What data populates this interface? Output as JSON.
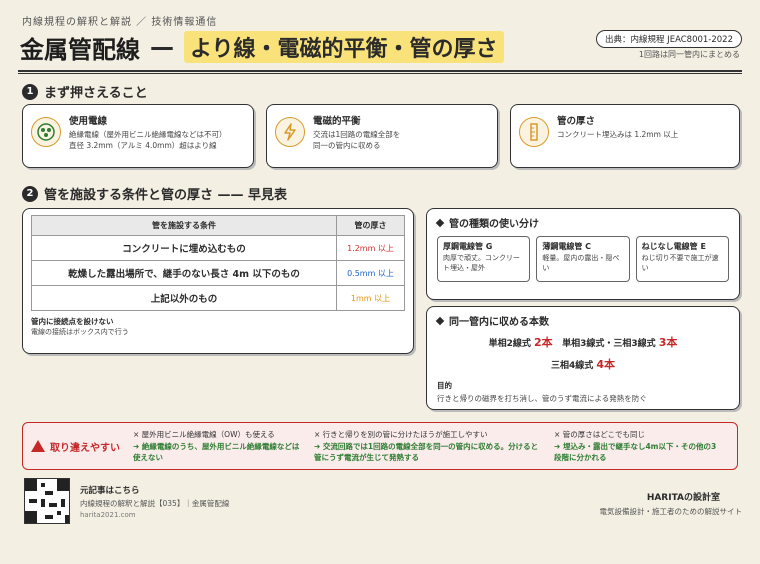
{
  "header": {
    "breadcrumb": "内線規程の解釈と解説 ／ 技術情報通信",
    "title_main": "金属管配線",
    "title_dash": "—",
    "title_sub": "より線・電磁的平衡・管の厚さ",
    "source": "出典：内線規程 JEAC8001-2022",
    "source_note": "1回路は同一管内にまとめる"
  },
  "section1": {
    "number": "1",
    "title": "まず押さえること",
    "cards": [
      {
        "title": "使用電線",
        "text1": "絶縁電線（屋外用ビニル絶縁電線などは不可）",
        "text2": "直径 3.2mm（アルミ 4.0mm）超はより線"
      },
      {
        "title": "電磁的平衡",
        "text1": "交流は1回路の電線全部を",
        "text2": "同一の管内に収める"
      },
      {
        "title": "管の厚さ",
        "text1": "コンクリート埋込みは 1.2mm 以上",
        "text2": ""
      }
    ]
  },
  "section2": {
    "number": "2",
    "title": "管を施設する条件と管の厚さ —— 早見表"
  },
  "table": {
    "headers": [
      "管を施設する条件",
      "管の厚さ"
    ],
    "rows": [
      {
        "condition": "コンクリートに埋め込むもの",
        "thickness": "1.2mm 以上",
        "color": "#d32f2f"
      },
      {
        "condition": "乾燥した露出場所で、継手のない長さ 4m 以下のもの",
        "thickness": "0.5mm 以上",
        "color": "#1e63c9"
      },
      {
        "condition": "上記以外のもの",
        "thickness": "1mm 以上",
        "color": "#e0950f"
      }
    ],
    "note_title": "管内に接続点を設けない",
    "note_text": "電線の接続はボックス内で行う"
  },
  "pipe_types": {
    "title": "管の種類の使い分け",
    "items": [
      {
        "name": "厚鋼電線管 G",
        "desc": "肉厚で頑丈。コンクリート埋込・屋外"
      },
      {
        "name": "薄鋼電線管 C",
        "desc": "軽量。屋内の露出・隠ぺい"
      },
      {
        "name": "ねじなし電線管 E",
        "desc": "ねじ切り不要で施工が速い"
      }
    ]
  },
  "wire_count": {
    "title": "同一管内に収める本数",
    "line1_a": "単相2線式",
    "line1_a_cnt": "2本",
    "line1_b": "単相3線式・三相3線式",
    "line1_b_cnt": "3本",
    "line2": "三相4線式",
    "line2_cnt": "4本",
    "purpose_title": "目的",
    "purpose_text": "行きと帰りの磁界を打ち消し、管のうず電流による発熱を防ぐ"
  },
  "mistakes": {
    "label": "取り違えやすい",
    "items": [
      {
        "wrong": "× 屋外用ビニル絶縁電線（OW）も使える",
        "fix": "➜ 絶縁電線のうち、屋外用ビニル絶縁電線などは使えない"
      },
      {
        "wrong": "× 行きと帰りを別の管に分けたほうが施工しやすい",
        "fix": "➜ 交流回路では1回路の電線全部を同一の管内に収める。分けると管にうず電流が生じて発熱する"
      },
      {
        "wrong": "× 管の厚さはどこでも同じ",
        "fix": "➜ 埋込み・露出で継手なし4m以下・その他の3段階に分かれる"
      }
    ]
  },
  "footer": {
    "title": "元記事はこちら",
    "line": "内線規程の解釈と解説【035】｜金属管配線",
    "url": "harita2021.com",
    "brand": "HARITAの設計室",
    "tagline": "電気設備設計・施工者のための解説サイト"
  }
}
